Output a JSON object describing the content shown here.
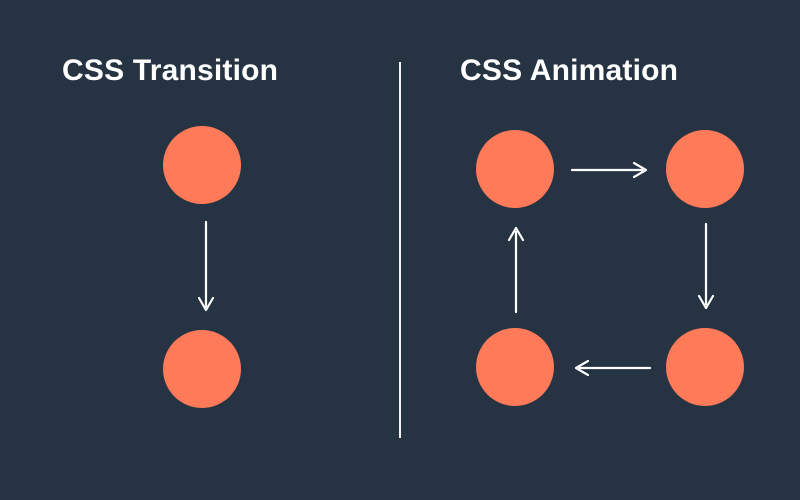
{
  "left": {
    "title": "CSS Transition"
  },
  "right": {
    "title": "CSS Animation"
  },
  "colors": {
    "background": "#253342",
    "circle": "#FF7A59",
    "text": "#FFFFFF",
    "arrow": "#FFFFFF"
  }
}
